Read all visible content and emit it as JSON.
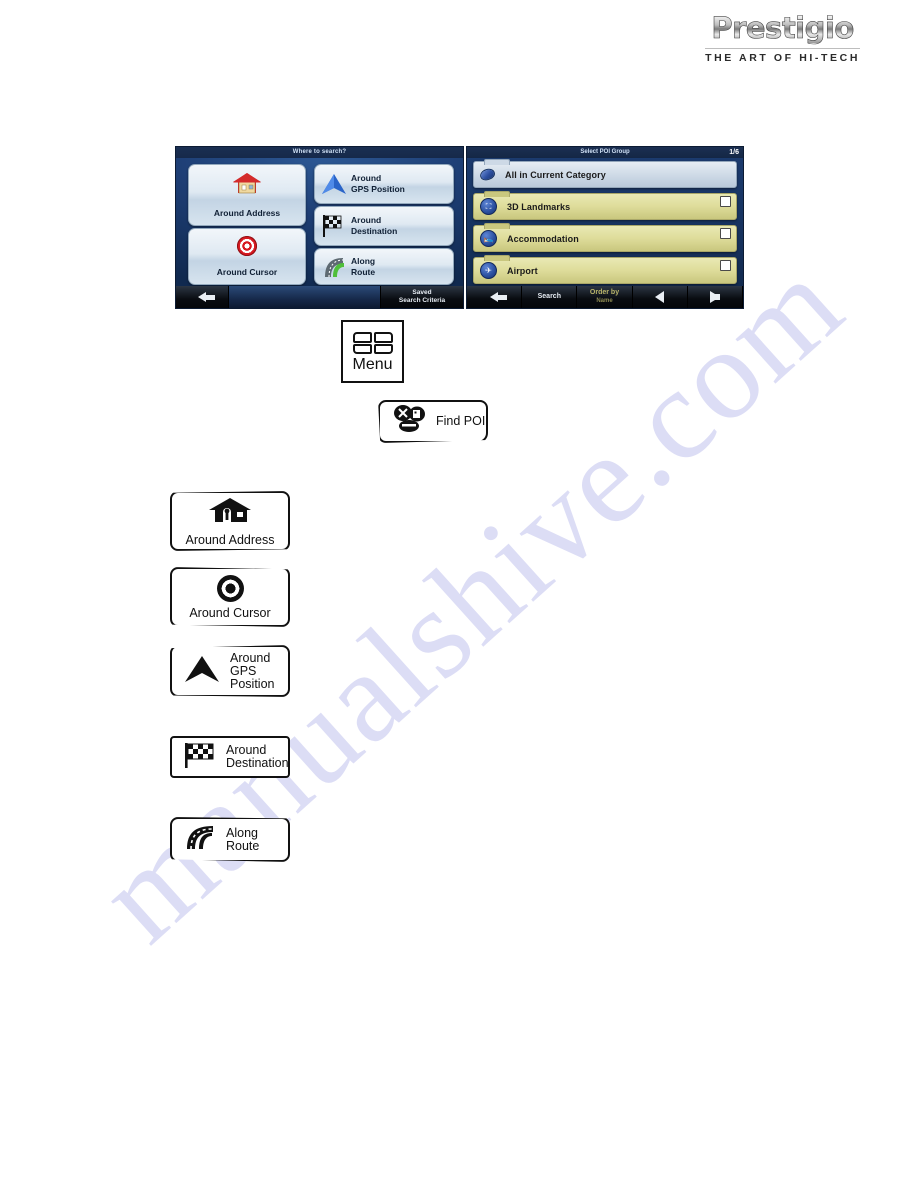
{
  "logo": {
    "brand": "Prestigio",
    "tagline": "THE ART OF HI-TECH"
  },
  "watermark": {
    "text": "manualshive.com"
  },
  "screenshot_where_to_search": {
    "title": "Where to search?",
    "buttons": [
      {
        "label": "Around Address",
        "icon": "house-icon"
      },
      {
        "label": "Around Cursor",
        "icon": "target-icon"
      },
      {
        "label": "Around\nGPS Position",
        "line1": "Around",
        "line2": "GPS Position",
        "icon": "gps-arrow-icon"
      },
      {
        "label": "Around\nDestination",
        "line1": "Around",
        "line2": "Destination",
        "icon": "checkered-flag-icon"
      },
      {
        "label": "Along\nRoute",
        "line1": "Along",
        "line2": "Route",
        "icon": "road-icon"
      }
    ],
    "bottom_bar": {
      "back_icon": "back-arrow-icon",
      "saved_line1": "Saved",
      "saved_line2": "Search Criteria"
    }
  },
  "screenshot_select_poi_group": {
    "title": "Select POI Group",
    "page_indicator": "1/6",
    "rows": [
      {
        "label": "All in Current Category",
        "icon": "poi-blob-icon",
        "checkbox": false,
        "highlighted": true
      },
      {
        "label": "3D Landmarks",
        "icon": "landmark-icon",
        "checkbox": true,
        "highlighted": false
      },
      {
        "label": "Accommodation",
        "icon": "bed-icon",
        "checkbox": true,
        "highlighted": false
      },
      {
        "label": "Airport",
        "icon": "airplane-icon",
        "checkbox": true,
        "highlighted": false
      }
    ],
    "bottom_bar": {
      "back_icon": "back-arrow-icon",
      "search_label": "Search",
      "order_label": "Order by",
      "order_sub": "Name",
      "prev_icon": "prev-triangle-icon",
      "next_icon": "next-triangle-icon"
    }
  },
  "instruction_buttons": {
    "menu": {
      "label": "Menu",
      "icon": "menu-grid-icon"
    },
    "find_poi": {
      "label": "Find POI",
      "icon": "find-poi-icon"
    },
    "around_address": {
      "label": "Around Address",
      "icon": "house-icon"
    },
    "around_cursor": {
      "label": "Around Cursor",
      "icon": "target-icon"
    },
    "around_gps": {
      "line1": "Around",
      "line2": "GPS Position",
      "icon": "gps-arrow-icon"
    },
    "around_destination": {
      "line1": "Around",
      "line2": "Destination",
      "icon": "checkered-flag-icon"
    },
    "along_route": {
      "line1": "Along",
      "line2": "Route",
      "icon": "road-icon"
    }
  },
  "colors": {
    "panel_blue": "#1c3c70",
    "poi_row_yellow": "#dedc9a",
    "poi_row_selected": "#cdd9e6",
    "order_by_accent": "#b8b46a",
    "house_roof_red": "#cc2222",
    "target_red": "#d71920",
    "watermark_violet": "#c8c9ef"
  }
}
